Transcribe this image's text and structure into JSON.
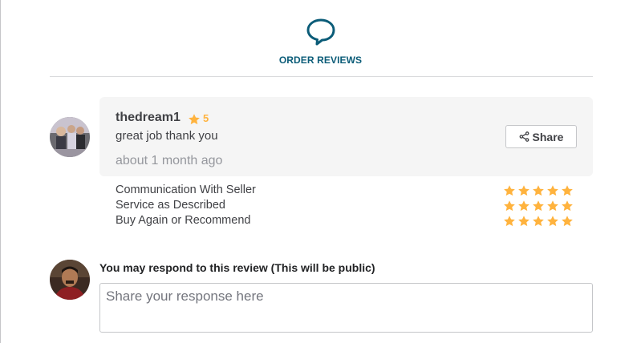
{
  "header": {
    "icon": "chat-bubble-icon",
    "title": "ORDER REVIEWS"
  },
  "review": {
    "username": "thedream1",
    "rating": "5",
    "text": "great job thank you",
    "time": "about 1 month ago",
    "share_label": "Share",
    "criteria": [
      {
        "label": "Communication With Seller",
        "stars": 5
      },
      {
        "label": "Service as Described",
        "stars": 5
      },
      {
        "label": "Buy Again or Recommend",
        "stars": 5
      }
    ]
  },
  "response": {
    "prompt": "You may respond to this review (This will be public)",
    "placeholder": "Share your response here"
  },
  "colors": {
    "accent": "#0b5c78",
    "star": "#ffb33e",
    "card_bg": "#f5f5f5"
  }
}
